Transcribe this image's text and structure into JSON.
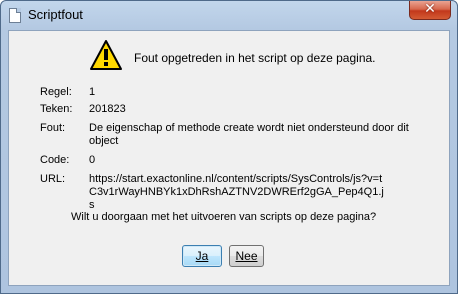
{
  "window": {
    "title": "Scriptfout",
    "close_glyph": "✕"
  },
  "message": "Fout opgetreden in het script op deze pagina.",
  "icon": "warning-icon",
  "details": [
    {
      "label": "Regel:",
      "value": "1"
    },
    {
      "label": "Teken:",
      "value": "201823"
    },
    {
      "label": "Fout:",
      "value": "De eigenschap of methode create wordt niet ondersteund door dit object"
    },
    {
      "label": "Code:",
      "value": "0"
    },
    {
      "label": "URL:",
      "value": "https://start.exactonline.nl/content/scripts/SysControls/js?v=tC3v1rWayHNBYk1xDhRshAZTNV2DWRErf2gGA_Pep4Q1.js"
    }
  ],
  "question": "Wilt u doorgaan met het uitvoeren van scripts op deze pagina?",
  "buttons": {
    "yes_label": "Ja",
    "no_label": "Nee"
  },
  "colors": {
    "close_button": "#c2381c",
    "warning_fill": "#ffd800",
    "dialog_background": "#f0f0f0"
  }
}
